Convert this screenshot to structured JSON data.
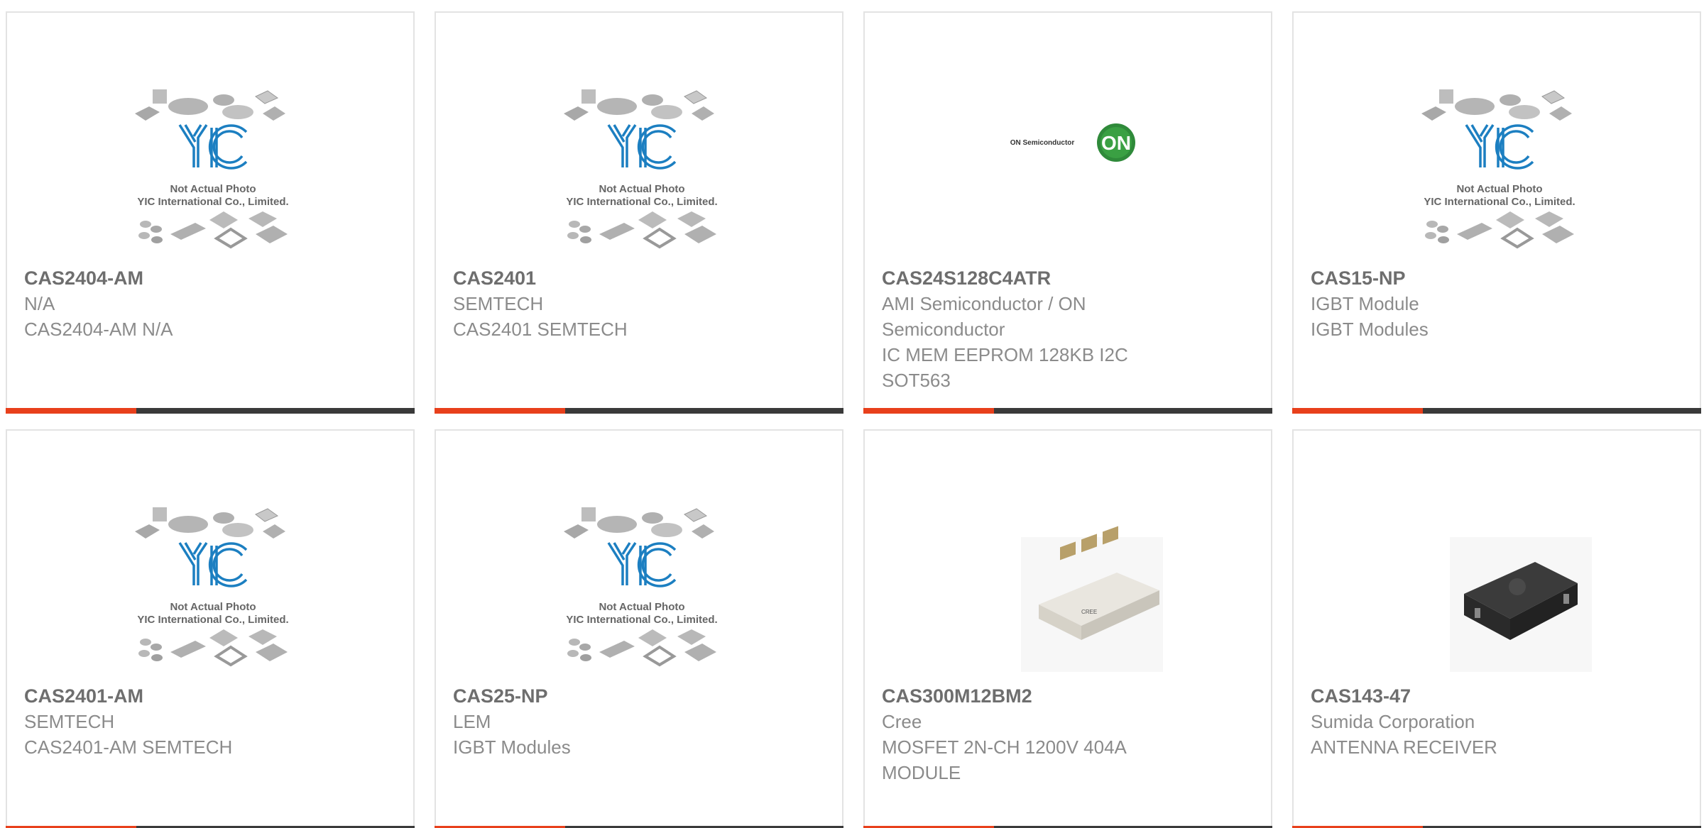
{
  "placeholder": {
    "line1": "Not Actual Photo",
    "line2": "YIC International Co., Limited."
  },
  "on_logo": {
    "text": "ON Semiconductor",
    "badge": "ON"
  },
  "colors": {
    "accent": "#e8401c",
    "bar": "#3a3a3a",
    "yic_blue": "#1c7fc1",
    "border": "#e3e3e3",
    "text": "#8b8b8b"
  },
  "products": [
    {
      "part_number": "CAS2404-AM",
      "manufacturer": "N/A",
      "desc_lines": [
        "CAS2404-AM N/A"
      ],
      "image": "yic-placeholder"
    },
    {
      "part_number": "CAS2401",
      "manufacturer": "SEMTECH",
      "desc_lines": [
        "CAS2401 SEMTECH"
      ],
      "image": "yic-placeholder"
    },
    {
      "part_number": "CAS24S128C4ATR",
      "manufacturer": "AMI Semiconductor / ON Semiconductor",
      "desc_lines": [
        "IC MEM EEPROM 128KB I2C",
        "SOT563"
      ],
      "image": "on-semiconductor-logo"
    },
    {
      "part_number": "CAS15-NP",
      "manufacturer": "IGBT Module",
      "desc_lines": [
        "IGBT Modules"
      ],
      "image": "yic-placeholder"
    },
    {
      "part_number": "CAS2401-AM",
      "manufacturer": "SEMTECH",
      "desc_lines": [
        "CAS2401-AM SEMTECH"
      ],
      "image": "yic-placeholder"
    },
    {
      "part_number": "CAS25-NP",
      "manufacturer": "LEM",
      "desc_lines": [
        "IGBT Modules"
      ],
      "image": "yic-placeholder"
    },
    {
      "part_number": "CAS300M12BM2",
      "manufacturer": "Cree",
      "desc_lines": [
        "MOSFET 2N-CH 1200V 404A",
        "MODULE"
      ],
      "image": "igbt-module-photo"
    },
    {
      "part_number": "CAS143-47",
      "manufacturer": "Sumida Corporation",
      "desc_lines": [
        "ANTENNA RECEIVER"
      ],
      "image": "antenna-receiver-photo"
    }
  ]
}
